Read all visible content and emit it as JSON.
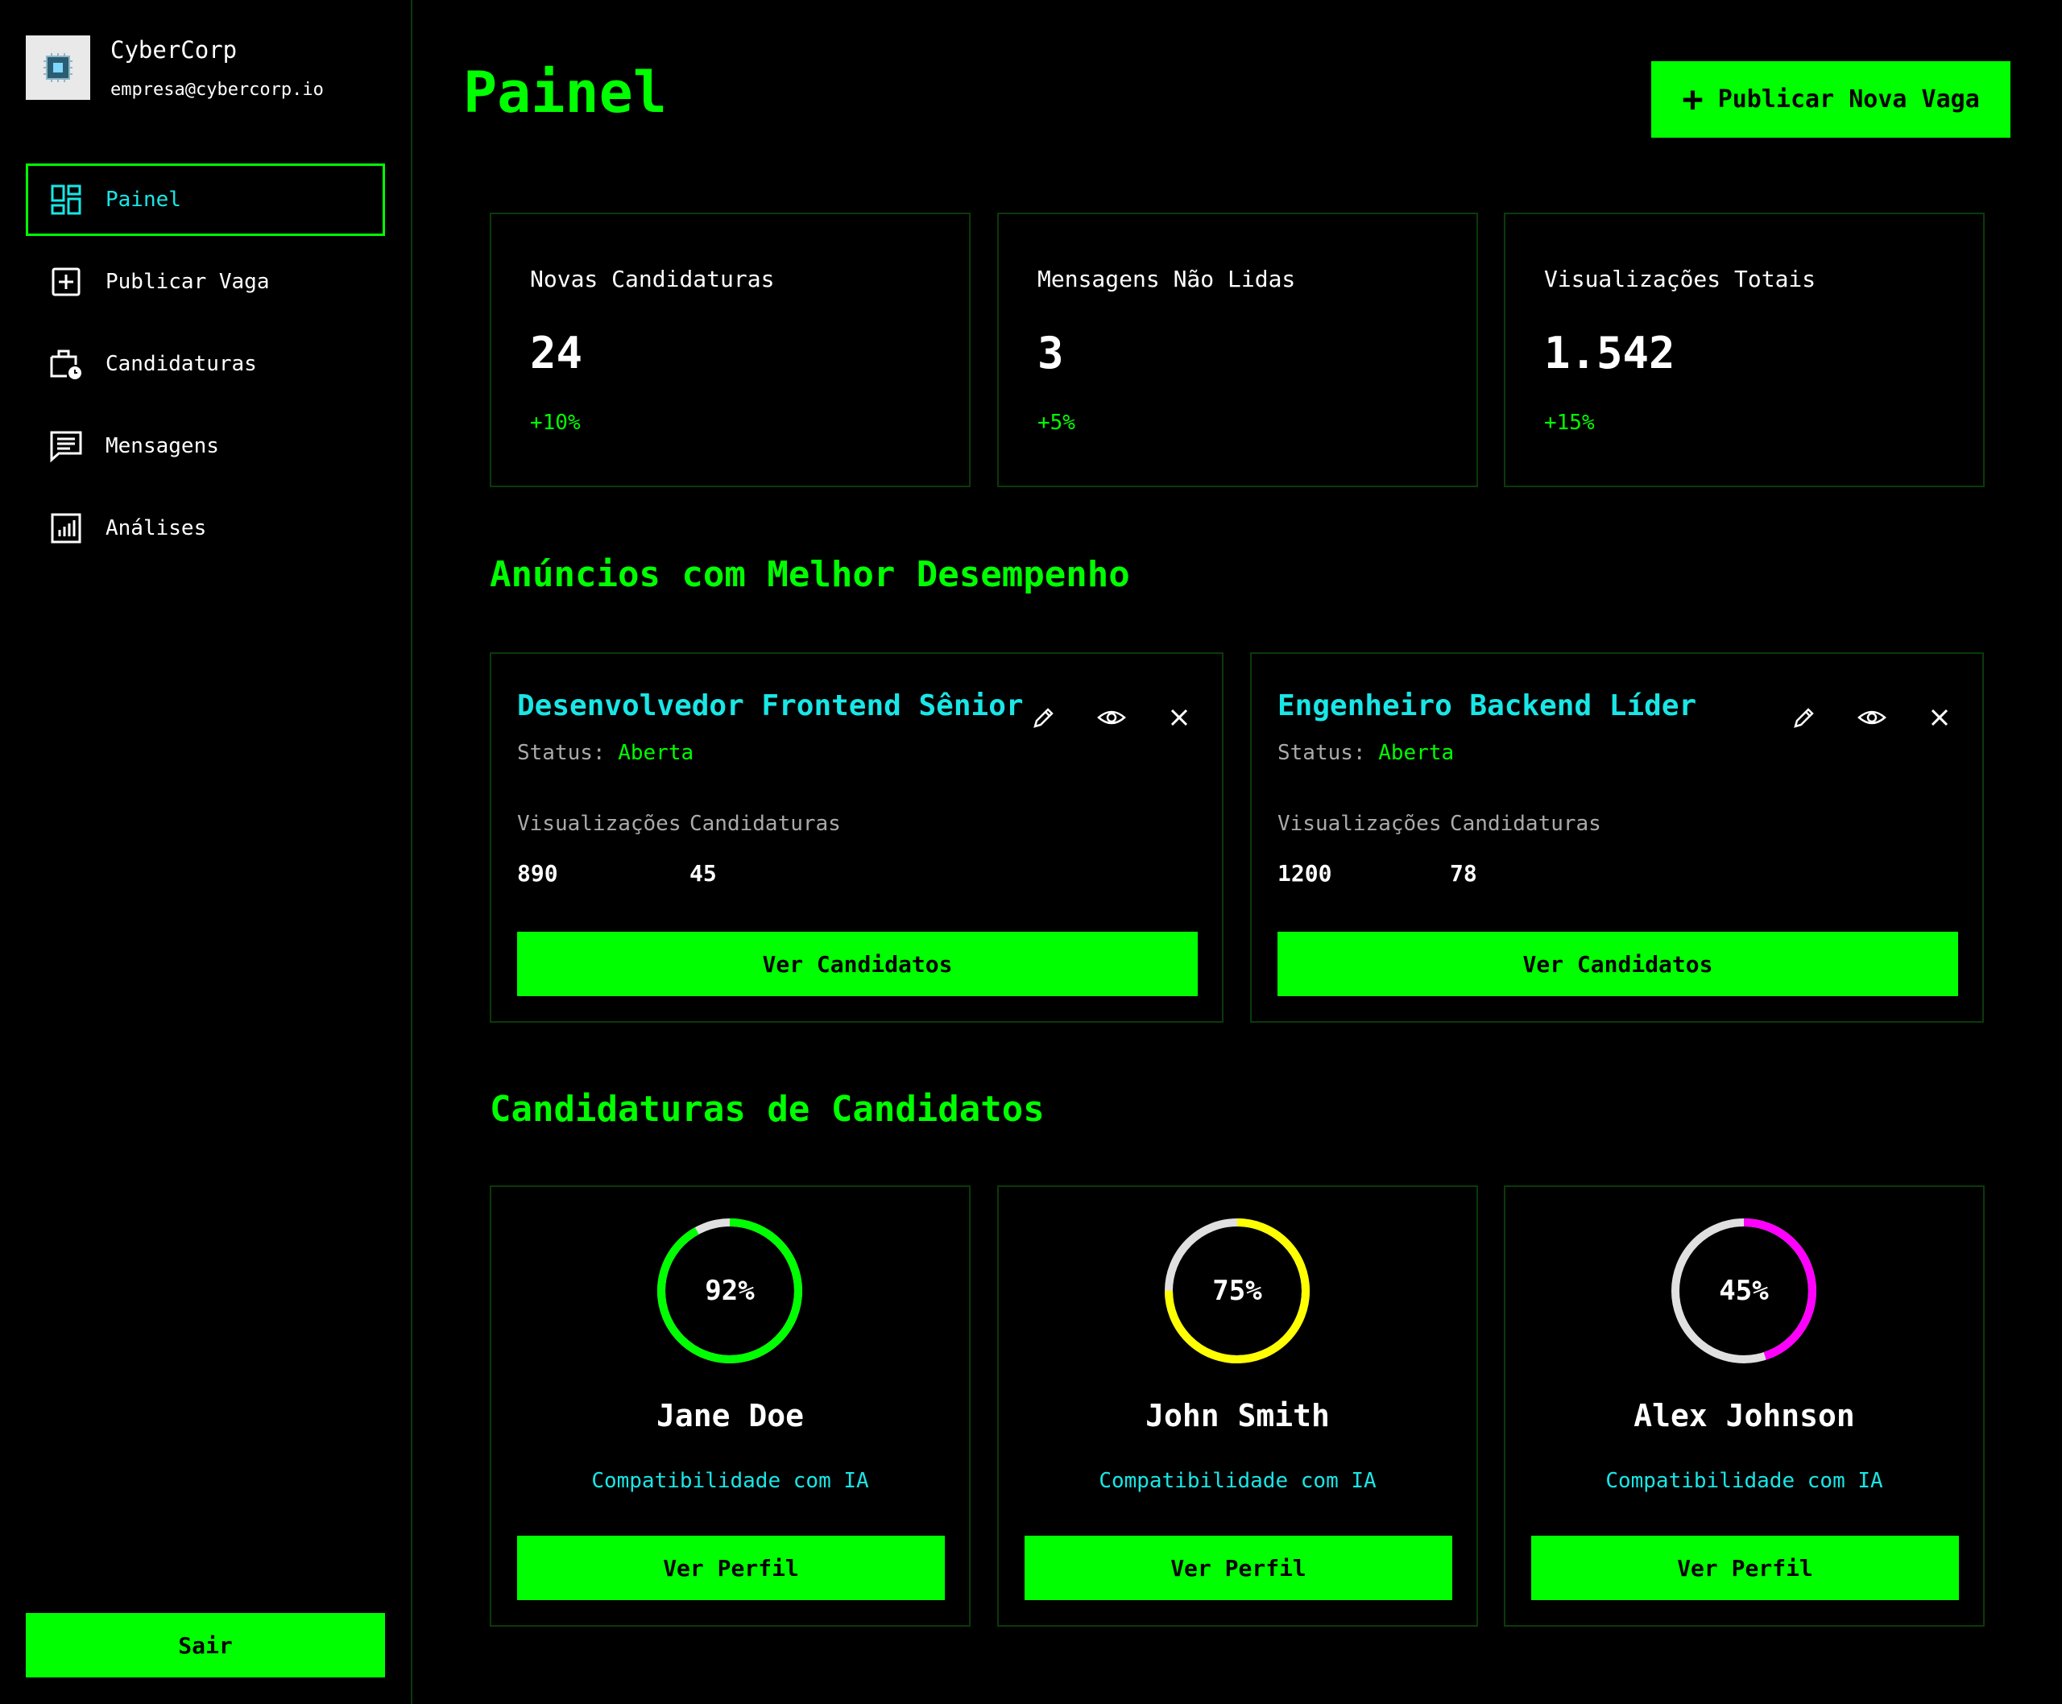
{
  "brand": {
    "name": "CyberCorp",
    "email": "empresa@cybercorp.io",
    "logo_icon": "chip-icon"
  },
  "sidebar": {
    "items": [
      {
        "label": "Painel",
        "icon": "dashboard-icon",
        "active": true
      },
      {
        "label": "Publicar Vaga",
        "icon": "add-box-icon",
        "active": false
      },
      {
        "label": "Candidaturas",
        "icon": "briefcase-clock-icon",
        "active": false
      },
      {
        "label": "Mensagens",
        "icon": "chat-icon",
        "active": false
      },
      {
        "label": "Análises",
        "icon": "bar-chart-icon",
        "active": false
      }
    ],
    "logout_label": "Sair"
  },
  "header": {
    "title": "Painel",
    "publish_label": "Publicar Nova Vaga"
  },
  "stats": [
    {
      "label": "Novas Candidaturas",
      "value": "24",
      "change": "+10%"
    },
    {
      "label": "Mensagens Não Lidas",
      "value": "3",
      "change": "+5%"
    },
    {
      "label": "Visualizações Totais",
      "value": "1.542",
      "change": "+15%"
    }
  ],
  "top_jobs": {
    "title": "Anúncios com Melhor Desempenho",
    "items": [
      {
        "title": "Desenvolvedor Frontend Sênior",
        "status_label": "Status:",
        "status": "Aberta",
        "views_label": "Visualizações",
        "views": "890",
        "apps_label": "Candidaturas",
        "apps": "45",
        "button": "Ver Candidatos"
      },
      {
        "title": "Engenheiro Backend Líder",
        "status_label": "Status:",
        "status": "Aberta",
        "views_label": "Visualizações",
        "views": "1200",
        "apps_label": "Candidaturas",
        "apps": "78",
        "button": "Ver Candidatos"
      }
    ]
  },
  "candidates": {
    "title": "Candidaturas de Candidatos",
    "items": [
      {
        "name": "Jane Doe",
        "match": "92%",
        "match_value": 92,
        "color": "#00ff00",
        "ai_label": "Compatibilidade com IA",
        "button": "Ver Perfil"
      },
      {
        "name": "John Smith",
        "match": "75%",
        "match_value": 75,
        "color": "#ffff00",
        "ai_label": "Compatibilidade com IA",
        "button": "Ver Perfil"
      },
      {
        "name": "Alex Johnson",
        "match": "45%",
        "match_value": 45,
        "color": "#ff00ff",
        "ai_label": "Compatibilidade com IA",
        "button": "Ver Perfil"
      }
    ]
  },
  "colors": {
    "accent": "#00ff00",
    "cyan": "#19e6e6",
    "border": "#0a3a0a",
    "ring_track": "#e0e0e0"
  }
}
